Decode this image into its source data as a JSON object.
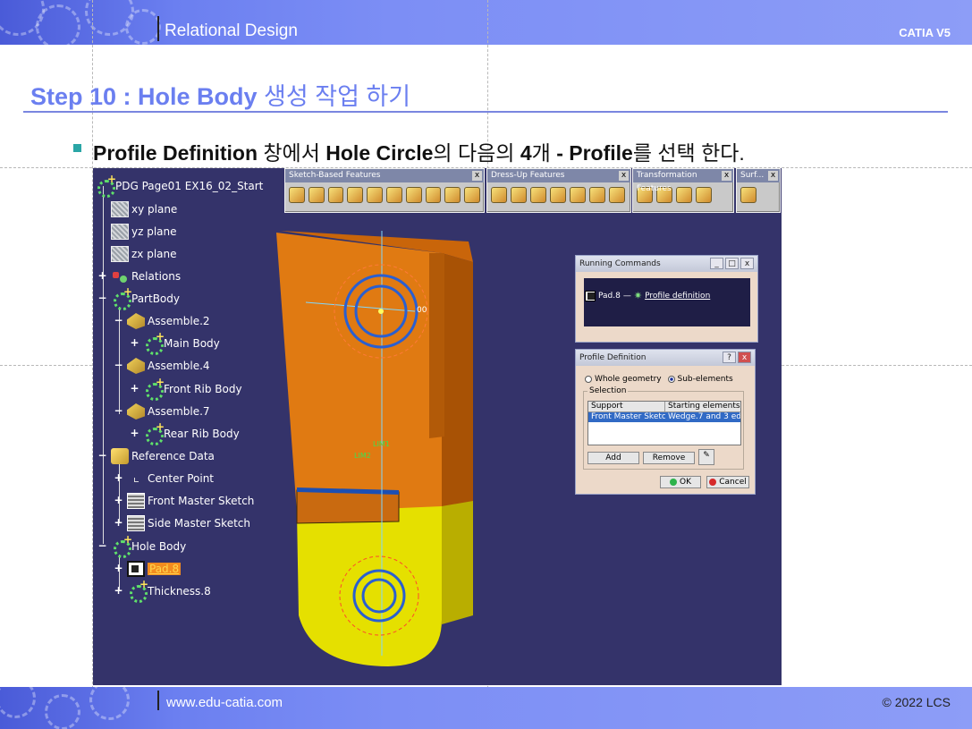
{
  "header": {
    "title": "Relational Design",
    "product": "CATIA V5"
  },
  "footer": {
    "website": "www.edu-catia.com",
    "copyright": "© 2022 LCS"
  },
  "slide": {
    "step_prefix": "Step 10 : Hole Body",
    "step_suffix": " 생성 작업 하기",
    "instruction": {
      "p1": "Profile Definition",
      "p2": " 창에서 ",
      "p3": "Hole Circle",
      "p4": "의 다음의 ",
      "p5": "4",
      "p6": "개 ",
      "p7": "- Profile",
      "p8": "를 선택 한다."
    }
  },
  "tree": {
    "root": "PDG Page01 EX16_02_Start",
    "xy": "xy plane",
    "yz": "yz plane",
    "zx": "zx plane",
    "relations": "Relations",
    "partbody": "PartBody",
    "assemble2": "Assemble.2",
    "mainbody": "Main Body",
    "assemble4": "Assemble.4",
    "frontrib": "Front Rib Body",
    "assemble7": "Assemble.7",
    "rearrib": "Rear Rib Body",
    "refdata": "Reference Data",
    "center": "Center Point",
    "frontsketch": "Front Master Sketch",
    "sidesketch": "Side Master Sketch",
    "holebody": "Hole Body",
    "pad8": "Pad.8",
    "thickness": "Thickness.8"
  },
  "toolbars": {
    "sketch": "Sketch-Based Features",
    "dressup": "Dress-Up Features",
    "transform": "Transformation Features",
    "surf": "Surf..."
  },
  "running_commands": {
    "title": "Running Commands",
    "pad": "Pad.8",
    "link": "Profile definition"
  },
  "profile_definition": {
    "title": "Profile Definition",
    "whole": "Whole geometry",
    "sub": "Sub-elements",
    "selection": "Selection",
    "col_support": "Support",
    "col_starting": "Starting elements",
    "row_support": "Front Master Sketch",
    "row_starting": "Wedge.7 and 3 ed...",
    "add": "Add",
    "remove": "Remove",
    "ok": "OK",
    "cancel": "Cancel"
  },
  "model": {
    "dim_label": "00",
    "tag1": "LIM1",
    "tag2": "LIM2"
  }
}
